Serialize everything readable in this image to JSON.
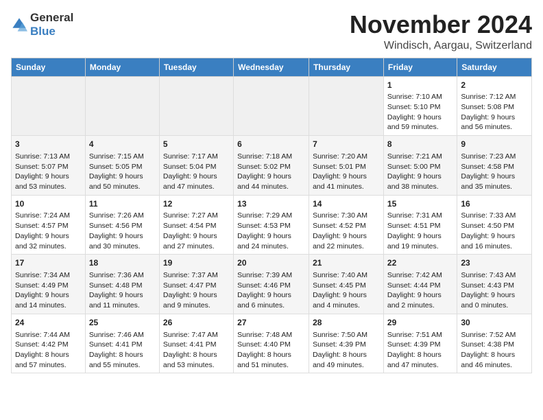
{
  "logo": {
    "text_general": "General",
    "text_blue": "Blue"
  },
  "header": {
    "month_year": "November 2024",
    "location": "Windisch, Aargau, Switzerland"
  },
  "weekdays": [
    "Sunday",
    "Monday",
    "Tuesday",
    "Wednesday",
    "Thursday",
    "Friday",
    "Saturday"
  ],
  "weeks": [
    [
      {
        "day": "",
        "info": ""
      },
      {
        "day": "",
        "info": ""
      },
      {
        "day": "",
        "info": ""
      },
      {
        "day": "",
        "info": ""
      },
      {
        "day": "",
        "info": ""
      },
      {
        "day": "1",
        "info": "Sunrise: 7:10 AM\nSunset: 5:10 PM\nDaylight: 9 hours and 59 minutes."
      },
      {
        "day": "2",
        "info": "Sunrise: 7:12 AM\nSunset: 5:08 PM\nDaylight: 9 hours and 56 minutes."
      }
    ],
    [
      {
        "day": "3",
        "info": "Sunrise: 7:13 AM\nSunset: 5:07 PM\nDaylight: 9 hours and 53 minutes."
      },
      {
        "day": "4",
        "info": "Sunrise: 7:15 AM\nSunset: 5:05 PM\nDaylight: 9 hours and 50 minutes."
      },
      {
        "day": "5",
        "info": "Sunrise: 7:17 AM\nSunset: 5:04 PM\nDaylight: 9 hours and 47 minutes."
      },
      {
        "day": "6",
        "info": "Sunrise: 7:18 AM\nSunset: 5:02 PM\nDaylight: 9 hours and 44 minutes."
      },
      {
        "day": "7",
        "info": "Sunrise: 7:20 AM\nSunset: 5:01 PM\nDaylight: 9 hours and 41 minutes."
      },
      {
        "day": "8",
        "info": "Sunrise: 7:21 AM\nSunset: 5:00 PM\nDaylight: 9 hours and 38 minutes."
      },
      {
        "day": "9",
        "info": "Sunrise: 7:23 AM\nSunset: 4:58 PM\nDaylight: 9 hours and 35 minutes."
      }
    ],
    [
      {
        "day": "10",
        "info": "Sunrise: 7:24 AM\nSunset: 4:57 PM\nDaylight: 9 hours and 32 minutes."
      },
      {
        "day": "11",
        "info": "Sunrise: 7:26 AM\nSunset: 4:56 PM\nDaylight: 9 hours and 30 minutes."
      },
      {
        "day": "12",
        "info": "Sunrise: 7:27 AM\nSunset: 4:54 PM\nDaylight: 9 hours and 27 minutes."
      },
      {
        "day": "13",
        "info": "Sunrise: 7:29 AM\nSunset: 4:53 PM\nDaylight: 9 hours and 24 minutes."
      },
      {
        "day": "14",
        "info": "Sunrise: 7:30 AM\nSunset: 4:52 PM\nDaylight: 9 hours and 22 minutes."
      },
      {
        "day": "15",
        "info": "Sunrise: 7:31 AM\nSunset: 4:51 PM\nDaylight: 9 hours and 19 minutes."
      },
      {
        "day": "16",
        "info": "Sunrise: 7:33 AM\nSunset: 4:50 PM\nDaylight: 9 hours and 16 minutes."
      }
    ],
    [
      {
        "day": "17",
        "info": "Sunrise: 7:34 AM\nSunset: 4:49 PM\nDaylight: 9 hours and 14 minutes."
      },
      {
        "day": "18",
        "info": "Sunrise: 7:36 AM\nSunset: 4:48 PM\nDaylight: 9 hours and 11 minutes."
      },
      {
        "day": "19",
        "info": "Sunrise: 7:37 AM\nSunset: 4:47 PM\nDaylight: 9 hours and 9 minutes."
      },
      {
        "day": "20",
        "info": "Sunrise: 7:39 AM\nSunset: 4:46 PM\nDaylight: 9 hours and 6 minutes."
      },
      {
        "day": "21",
        "info": "Sunrise: 7:40 AM\nSunset: 4:45 PM\nDaylight: 9 hours and 4 minutes."
      },
      {
        "day": "22",
        "info": "Sunrise: 7:42 AM\nSunset: 4:44 PM\nDaylight: 9 hours and 2 minutes."
      },
      {
        "day": "23",
        "info": "Sunrise: 7:43 AM\nSunset: 4:43 PM\nDaylight: 9 hours and 0 minutes."
      }
    ],
    [
      {
        "day": "24",
        "info": "Sunrise: 7:44 AM\nSunset: 4:42 PM\nDaylight: 8 hours and 57 minutes."
      },
      {
        "day": "25",
        "info": "Sunrise: 7:46 AM\nSunset: 4:41 PM\nDaylight: 8 hours and 55 minutes."
      },
      {
        "day": "26",
        "info": "Sunrise: 7:47 AM\nSunset: 4:41 PM\nDaylight: 8 hours and 53 minutes."
      },
      {
        "day": "27",
        "info": "Sunrise: 7:48 AM\nSunset: 4:40 PM\nDaylight: 8 hours and 51 minutes."
      },
      {
        "day": "28",
        "info": "Sunrise: 7:50 AM\nSunset: 4:39 PM\nDaylight: 8 hours and 49 minutes."
      },
      {
        "day": "29",
        "info": "Sunrise: 7:51 AM\nSunset: 4:39 PM\nDaylight: 8 hours and 47 minutes."
      },
      {
        "day": "30",
        "info": "Sunrise: 7:52 AM\nSunset: 4:38 PM\nDaylight: 8 hours and 46 minutes."
      }
    ]
  ]
}
